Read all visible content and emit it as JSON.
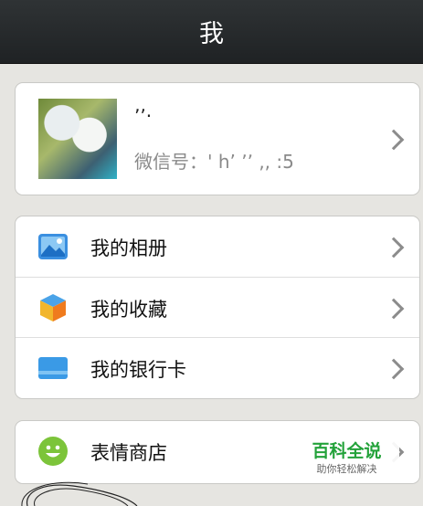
{
  "header": {
    "title": "我"
  },
  "profile": {
    "nickname": "ʼʼ·",
    "wechat_id_label": "微信号：",
    "wechat_id_value": "' h’ ʼʼ   ,,  :5"
  },
  "menu_group1": [
    {
      "label": "我的相册",
      "icon": "photo-album-icon"
    },
    {
      "label": "我的收藏",
      "icon": "favorites-cube-icon"
    },
    {
      "label": "我的银行卡",
      "icon": "bank-card-icon"
    }
  ],
  "menu_group2": [
    {
      "label": "表情商店",
      "icon": "smiley-icon"
    }
  ],
  "watermark": {
    "main": "百科全说",
    "sub": "助你轻松解决"
  },
  "colors": {
    "header_bg": "#1f2224",
    "page_bg": "#e6e5e1",
    "watermark_green": "#23a23a"
  }
}
